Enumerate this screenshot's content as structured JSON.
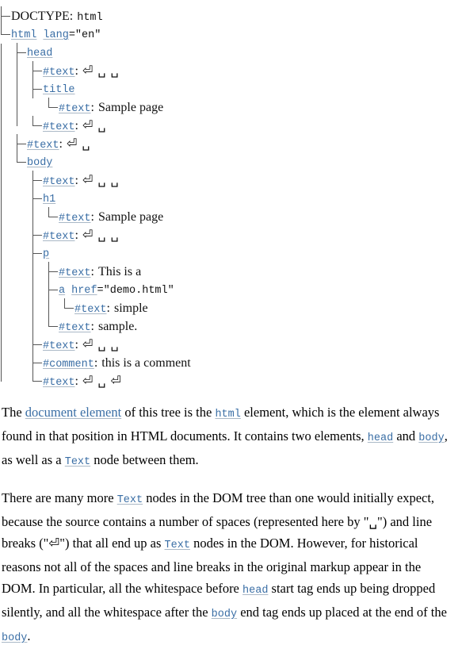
{
  "symbols": {
    "newline": "⏎",
    "space": "␣"
  },
  "tree": {
    "doctype_label": "DOCTYPE",
    "doctype_value": "html",
    "nodes": {
      "html": "html",
      "lang_attr_name": "lang",
      "lang_attr_value": "=\"en\"",
      "head": "head",
      "title": "title",
      "body": "body",
      "h1": "h1",
      "p": "p",
      "a": "a",
      "href_attr_name": "href",
      "href_attr_value": "=\"demo.html\"",
      "text": "#text",
      "comment": "#comment"
    },
    "values": {
      "head_ws_1": "⏎ ␣ ␣",
      "title_text": "Sample page",
      "head_ws_2": "⏎ ␣",
      "html_ws": "⏎ ␣",
      "body_ws_1": "⏎ ␣ ␣",
      "h1_text": "Sample page",
      "body_ws_2": "⏎ ␣ ␣",
      "p_text_1": "This is a",
      "a_text": "simple",
      "p_text_2": "sample.",
      "body_ws_3": "⏎ ␣ ␣",
      "comment_text": "this is a comment",
      "body_ws_4": "⏎ ␣ ⏎"
    },
    "colon": ":"
  },
  "paragraphs": {
    "p1": {
      "part1": "The ",
      "link1": "document element",
      "part2": " of this tree is the ",
      "code1": "html",
      "part3": " element, which is the element always found in that position in HTML documents. It contains two elements, ",
      "code2": "head",
      "part4": " and ",
      "code3": "body",
      "part5": ", as well as a ",
      "code4": "Text",
      "part6": " node between them."
    },
    "p2": {
      "part1": "There are many more ",
      "code1": "Text",
      "part2": " nodes in the DOM tree than one would initially expect, because the source contains a number of spaces (represented here by \"",
      "sym1": "␣",
      "part3": "\") and line breaks (\"",
      "sym2": "⏎",
      "part4": "\") that all end up as ",
      "code2": "Text",
      "part5": " nodes in the DOM. However, for historical reasons not all of the spaces and line breaks in the original markup appear in the DOM. In particular, all the whitespace before ",
      "code3": "head",
      "part6": " start tag ends up being dropped silently, and all the whitespace after the ",
      "code4": "body",
      "part7": " end tag ends up placed at the end of the ",
      "code5": "body",
      "part8": "."
    }
  },
  "colors": {
    "link": "#3a6ea5",
    "text": "#000000",
    "connector": "#555555",
    "underline": "#aab8c6",
    "background": "#ffffff"
  }
}
